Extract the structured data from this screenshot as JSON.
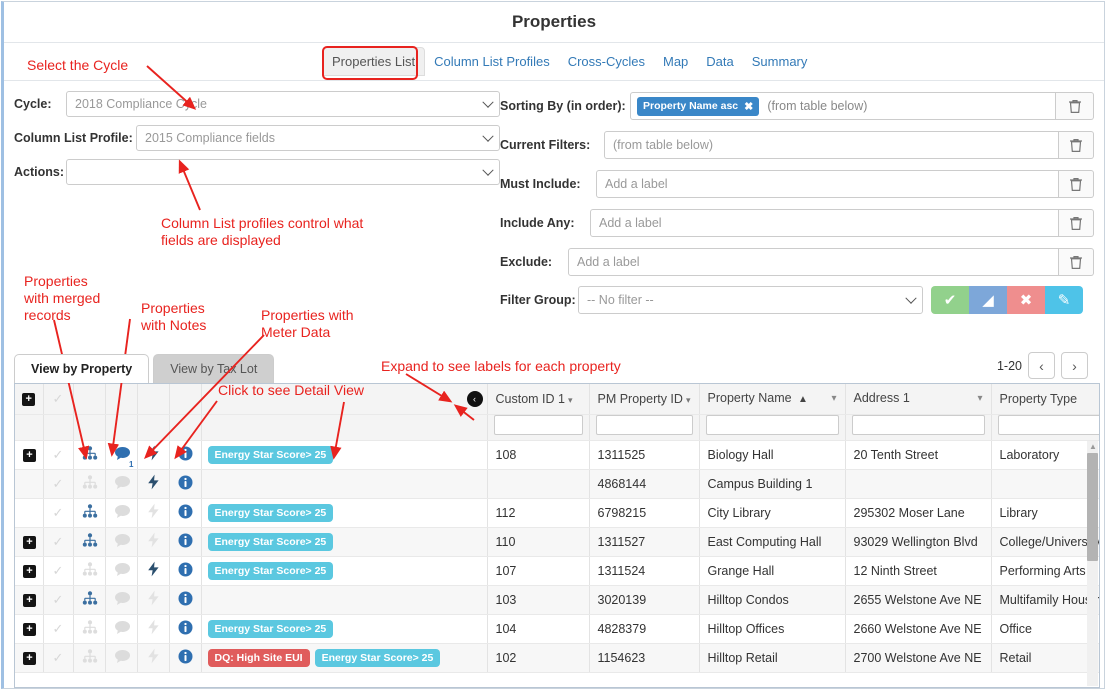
{
  "header": {
    "title": "Properties"
  },
  "nav": {
    "tabs": [
      {
        "label": "Properties List",
        "active": true
      },
      {
        "label": "Column List Profiles",
        "active": false
      },
      {
        "label": "Cross-Cycles",
        "active": false
      },
      {
        "label": "Map",
        "active": false
      },
      {
        "label": "Data",
        "active": false
      },
      {
        "label": "Summary",
        "active": false
      }
    ]
  },
  "form": {
    "cycle": {
      "label": "Cycle:",
      "value": "2018 Compliance Cycle"
    },
    "column_list_profile": {
      "label": "Column List Profile:",
      "value": "2015 Compliance fields"
    },
    "actions": {
      "label": "Actions:",
      "value": ""
    },
    "sorting_by": {
      "label": "Sorting By (in order):",
      "chip": "Property Name asc",
      "chip_close": "✖",
      "hint": "(from table below)"
    },
    "current_filters": {
      "label": "Current Filters:",
      "placeholder": "(from table below)"
    },
    "must_include": {
      "label": "Must Include:",
      "placeholder": "Add a label"
    },
    "include_any": {
      "label": "Include Any:",
      "placeholder": "Add a label"
    },
    "exclude": {
      "label": "Exclude:",
      "placeholder": "Add a label"
    },
    "filter_group": {
      "label": "Filter Group:",
      "value": "-- No filter --",
      "buttons": [
        {
          "name": "apply",
          "glyph": "✔",
          "color": "#92d18c"
        },
        {
          "name": "clear",
          "glyph": "◢",
          "color": "#7da7d9"
        },
        {
          "name": "delete",
          "glyph": "✖",
          "color": "#ef8e8e"
        },
        {
          "name": "edit",
          "glyph": "✎",
          "color": "#4ec3e8"
        }
      ]
    },
    "trash_glyph": "🗑"
  },
  "annotations": [
    {
      "id": "select-cycle",
      "text": "Select the Cycle"
    },
    {
      "id": "column-list-profiles-note",
      "text": "Column List profiles control what\nfields are displayed"
    },
    {
      "id": "merged-records-note",
      "text": "Properties\nwith merged\nrecords"
    },
    {
      "id": "notes-note",
      "text": "Properties\nwith Notes"
    },
    {
      "id": "meter-data-note",
      "text": "Properties with\nMeter Data"
    },
    {
      "id": "detail-view-note",
      "text": "Click to see Detail View"
    },
    {
      "id": "expand-labels-note",
      "text": "Expand to see labels for each property"
    }
  ],
  "table": {
    "view_tabs": [
      {
        "label": "View by Property",
        "active": true
      },
      {
        "label": "View by Tax Lot",
        "active": false
      }
    ],
    "pager": {
      "range": "1-20",
      "prev": "‹",
      "next": "›"
    },
    "collapse_glyph": "‹",
    "columns": [
      {
        "key": "expand",
        "label": "",
        "cls": "c-expand"
      },
      {
        "key": "check",
        "label": "",
        "cls": "c-check"
      },
      {
        "key": "merged",
        "label": "",
        "cls": "c-icon"
      },
      {
        "key": "notes",
        "label": "",
        "cls": "c-icon"
      },
      {
        "key": "meter",
        "label": "",
        "cls": "c-icon"
      },
      {
        "key": "info",
        "label": "",
        "cls": "c-icon"
      },
      {
        "key": "labels",
        "label": "",
        "cls": "c-labels"
      },
      {
        "key": "custom_id_1",
        "label": "Custom ID 1",
        "cls": "c-cid",
        "sortable": true
      },
      {
        "key": "pm_property_id",
        "label": "PM Property ID",
        "cls": "c-pmid",
        "sortable": true
      },
      {
        "key": "property_name",
        "label": "Property Name",
        "cls": "c-pname",
        "sorted": "asc"
      },
      {
        "key": "address_1",
        "label": "Address 1",
        "cls": "c-addr"
      },
      {
        "key": "property_type",
        "label": "Property Type",
        "cls": "c-ptype"
      },
      {
        "key": "menu",
        "label": "",
        "cls": "c-burger"
      }
    ],
    "rows": [
      {
        "expand": true,
        "merged": true,
        "notes": true,
        "notes_count": "1",
        "meter": true,
        "info": true,
        "labels": [
          {
            "text": "Energy Star Score> 25",
            "type": "info"
          }
        ],
        "custom_id_1": "108",
        "pm_property_id": "1311525",
        "property_name": "Biology Hall",
        "address_1": "20 Tenth Street",
        "property_type": "Laboratory"
      },
      {
        "expand": false,
        "merged": false,
        "notes": false,
        "meter": true,
        "info": true,
        "labels": [],
        "custom_id_1": "",
        "pm_property_id": "4868144",
        "property_name": "Campus Building 1",
        "address_1": "",
        "property_type": ""
      },
      {
        "expand": false,
        "merged": true,
        "notes": false,
        "meter": false,
        "info": true,
        "labels": [
          {
            "text": "Energy Star Score> 25",
            "type": "info"
          }
        ],
        "custom_id_1": "112",
        "pm_property_id": "6798215",
        "property_name": "City Library",
        "address_1": "295302 Moser Lane",
        "property_type": "Library"
      },
      {
        "expand": true,
        "merged": true,
        "notes": false,
        "meter": false,
        "info": true,
        "labels": [
          {
            "text": "Energy Star Score> 25",
            "type": "info"
          }
        ],
        "custom_id_1": "110",
        "pm_property_id": "1311527",
        "property_name": "East Computing Hall",
        "address_1": "93029 Wellington Blvd",
        "property_type": "College/University"
      },
      {
        "expand": true,
        "merged": false,
        "notes": false,
        "meter": true,
        "info": true,
        "labels": [
          {
            "text": "Energy Star Score> 25",
            "type": "info"
          }
        ],
        "custom_id_1": "107",
        "pm_property_id": "1311524",
        "property_name": "Grange Hall",
        "address_1": "12 Ninth Street",
        "property_type": "Performing Arts"
      },
      {
        "expand": true,
        "merged": true,
        "notes": false,
        "meter": false,
        "info": true,
        "labels": [],
        "custom_id_1": "103",
        "pm_property_id": "3020139",
        "property_name": "Hilltop Condos",
        "address_1": "2655 Welstone Ave NE",
        "property_type": "Multifamily Housing"
      },
      {
        "expand": true,
        "merged": false,
        "notes": false,
        "meter": false,
        "info": true,
        "labels": [
          {
            "text": "Energy Star Score> 25",
            "type": "info"
          }
        ],
        "custom_id_1": "104",
        "pm_property_id": "4828379",
        "property_name": "Hilltop Offices",
        "address_1": "2660 Welstone Ave NE",
        "property_type": "Office"
      },
      {
        "expand": true,
        "merged": false,
        "notes": false,
        "meter": false,
        "info": true,
        "labels": [
          {
            "text": "DQ: High Site EUI",
            "type": "danger"
          },
          {
            "text": "Energy Star Score> 25",
            "type": "info"
          }
        ],
        "custom_id_1": "102",
        "pm_property_id": "1154623",
        "property_name": "Hilltop Retail",
        "address_1": "2700 Welstone Ave NE",
        "property_type": "Retail"
      }
    ]
  },
  "colors": {
    "accent_blue": "#337ab7",
    "chip_blue": "#3a87c8",
    "badge_info": "#5bc8e0",
    "badge_danger": "#e05c5c",
    "annotation_red": "#e8231f"
  }
}
